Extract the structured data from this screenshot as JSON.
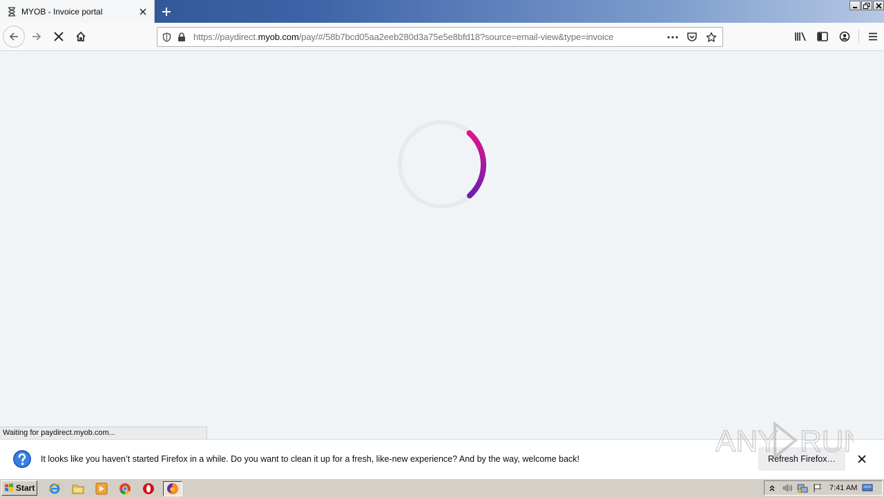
{
  "browser": {
    "tab": {
      "title": "MYOB - Invoice portal"
    },
    "url": {
      "prefix": "https://paydirect.",
      "domain": "myob.com",
      "path": "/pay/#/58b7bcd05aa2eeb280d3a75e5e8bfd18?source=email-view&type=invoice"
    },
    "status_text": "Waiting for paydirect.myob.com..."
  },
  "page": {
    "loading": true,
    "spinner_colors": [
      "#e0138c",
      "#6b1fb1"
    ]
  },
  "notification": {
    "message": "It looks like you haven’t started Firefox in a while. Do you want to clean it up for a fresh, like-new experience? And by the way, welcome back!",
    "button_label": "Refresh Firefox…"
  },
  "watermark": {
    "text": "ANY RUN"
  },
  "taskbar": {
    "start_label": "Start",
    "clock": "7:41 AM",
    "quick_launch": [
      "ie-icon",
      "folder-icon",
      "media-player-icon",
      "chrome-icon",
      "opera-icon",
      "firefox-icon"
    ]
  }
}
